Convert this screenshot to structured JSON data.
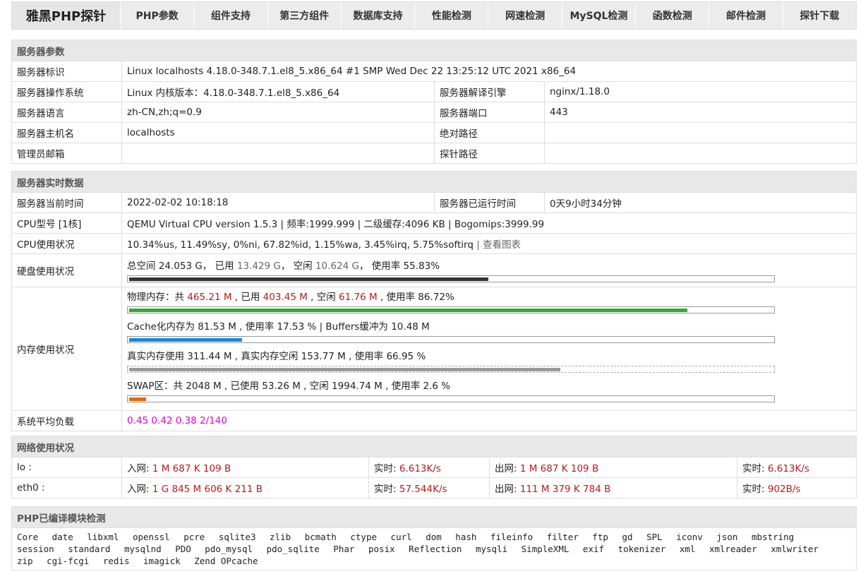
{
  "nav": {
    "brand": "雅黑PHP探针",
    "items": [
      "PHP参数",
      "组件支持",
      "第三方组件",
      "数据库支持",
      "性能检测",
      "网速检测",
      "MySQL检测",
      "函数检测",
      "邮件检测",
      "探针下载"
    ]
  },
  "server_params": {
    "title": "服务器参数",
    "id_label": "服务器标识",
    "id_value": "Linux localhosts 4.18.0-348.7.1.el8_5.x86_64 #1 SMP Wed Dec 22 13:25:12 UTC 2021 x86_64",
    "os_label": "服务器操作系统",
    "os_value": "Linux  内核版本：4.18.0-348.7.1.el8_5.x86_64",
    "engine_label": "服务器解译引擎",
    "engine_value": "nginx/1.18.0",
    "lang_label": "服务器语言",
    "lang_value": "zh-CN,zh;q=0.9",
    "port_label": "服务器端口",
    "port_value": "443",
    "host_label": "服务器主机名",
    "host_value": "localhosts",
    "abspath_label": "绝对路径",
    "abspath_value": "",
    "email_label": "管理员邮箱",
    "email_value": "",
    "probepath_label": "探针路径",
    "probepath_value": ""
  },
  "realtime": {
    "title": "服务器实时数据",
    "time_label": "服务器当前时间",
    "time_value": "2022-02-02 10:18:18",
    "uptime_label": "服务器已运行时间",
    "uptime_value": "0天9小时34分钟",
    "cpu_model_label": "CPU型号 [1核]",
    "cpu_model_value": "QEMU Virtual CPU version 1.5.3 | 频率:1999.999 | 二级缓存:4096 KB | Bogomips:3999.99",
    "cpu_usage_label": "CPU使用状况",
    "cpu_usage_value": "10.34%us, 11.49%sy, 0%ni, 67.82%id, 1.15%wa, 3.45%irq, 5.75%softirq",
    "cpu_chart_link": "| 查看图表",
    "disk_label": "硬盘使用状况",
    "disk": {
      "total_prefix": "总空间 24.053 G，  已用",
      "used": "13.429 G",
      "free_prefix": "，  空闲",
      "free": "10.624 G",
      "rate_text": "，  使用率 55.83%",
      "fill_percent": 55.83
    },
    "mem_label": "内存使用状况",
    "physical": {
      "t1": "物理内存：共",
      "total": "465.21 M",
      "t2": ", 已用",
      "used": "403.45 M",
      "t3": ", 空闲",
      "free": "61.76 M",
      "t4": ", 使用率 86.72%",
      "fill_percent": 86.72
    },
    "cache": {
      "text": "Cache化内存为 81.53 M , 使用率 17.53 % | Buffers缓冲为 10.48 M",
      "fill_percent": 17.53
    },
    "real": {
      "text": "真实内存使用 311.44 M , 真实内存空闲 153.77 M , 使用率 66.95 %",
      "fill_percent": 66.95
    },
    "swap": {
      "text": "SWAP区：共 2048 M , 已使用 53.26 M , 空闲 1994.74 M , 使用率 2.6 %",
      "fill_percent": 2.6
    },
    "load_label": "系统平均负载",
    "load_value": "0.45 0.42 0.38 2/140",
    "colors": {
      "disk": "#333333",
      "physical": "#33aa33",
      "cache": "#1188dd",
      "real": "#999999",
      "swap": "#ee6600"
    }
  },
  "network": {
    "title": "网络使用状况",
    "rows": [
      {
        "name": "lo :",
        "in_label": "入网:",
        "in_value": "1 M 687 K 109 B",
        "in_rt_label": "实时:",
        "in_rt_value": "6.613K/s",
        "out_label": "出网:",
        "out_value": "1 M 687 K 109 B",
        "out_rt_label": "实时:",
        "out_rt_value": "6.613K/s"
      },
      {
        "name": "eth0 :",
        "in_label": "入网:",
        "in_value": "1 G 845 M 606 K 211 B",
        "in_rt_label": "实时:",
        "in_rt_value": "57.544K/s",
        "out_label": "出网:",
        "out_value": "111 M 379 K 784 B",
        "out_rt_label": "实时:",
        "out_rt_value": "902B/s"
      }
    ]
  },
  "modules": {
    "title": "PHP已编译模块检测",
    "list": [
      "Core",
      "date",
      "libxml",
      "openssl",
      "pcre",
      "sqlite3",
      "zlib",
      "bcmath",
      "ctype",
      "curl",
      "dom",
      "hash",
      "fileinfo",
      "filter",
      "ftp",
      "gd",
      "SPL",
      "iconv",
      "json",
      "mbstring",
      "session",
      "standard",
      "mysqlnd",
      "PDO",
      "pdo_mysql",
      "pdo_sqlite",
      "Phar",
      "posix",
      "Reflection",
      "mysqli",
      "SimpleXML",
      "exif",
      "tokenizer",
      "xml",
      "xmlreader",
      "xmlwriter",
      "zip",
      "cgi-fcgi",
      "redis",
      "imagick",
      "Zend OPcache"
    ]
  }
}
